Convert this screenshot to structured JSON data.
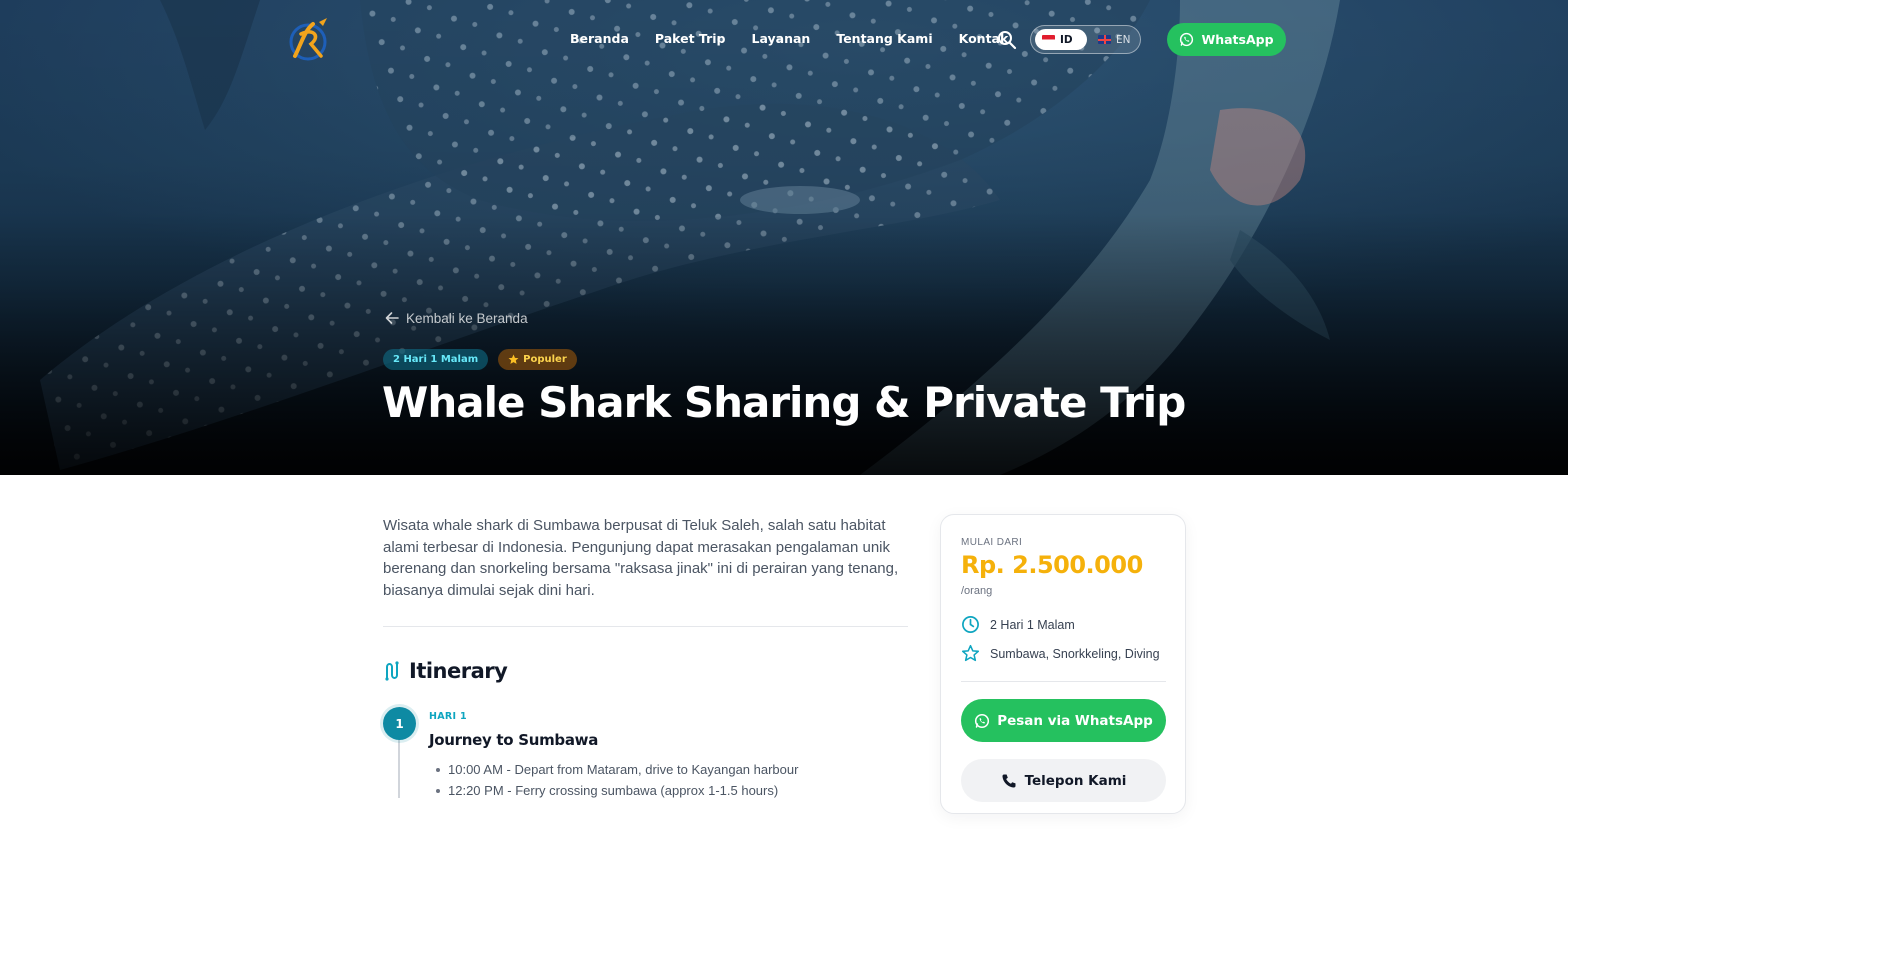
{
  "nav": {
    "links": [
      "Beranda",
      "Paket Trip",
      "Layanan",
      "Tentang Kami",
      "Kontak"
    ],
    "lang": {
      "id": "ID",
      "en": "EN",
      "active": "ID"
    },
    "whatsapp_label": "WhatsApp"
  },
  "hero": {
    "back_label": "Kembali ke Beranda",
    "badge_duration": "2 Hari 1 Malam",
    "badge_popular": "Populer",
    "title": "Whale Shark Sharing & Private Trip"
  },
  "intro": "Wisata whale shark di Sumbawa berpusat di Teluk Saleh, salah satu habitat alami terbesar di Indonesia. Pengunjung dapat merasakan pengalaman unik berenang dan snorkeling bersama \"raksasa jinak\" ini di perairan yang tenang, biasanya dimulai sejak dini hari.",
  "itinerary": {
    "title": "Itinerary",
    "days": [
      {
        "number": "1",
        "label": "HARI 1",
        "title": "Journey to Sumbawa",
        "items": [
          "10:00 AM - Depart from Mataram, drive to Kayangan harbour",
          "12:20 PM - Ferry crossing sumbawa (approx 1-1.5 hours)"
        ]
      }
    ]
  },
  "card": {
    "label": "MULAI DARI",
    "price": "Rp. 2.500.000",
    "unit": "/orang",
    "duration": "2 Hari 1 Malam",
    "tags": "Sumbawa, Snorkkeling, Diving",
    "whatsapp_label": "Pesan via WhatsApp",
    "call_label": "Telepon Kami"
  },
  "colors": {
    "whatsapp_green": "#25c15f",
    "accent_teal": "#0e8aa3",
    "price_gold": "#f5b10b"
  },
  "icons": {
    "logo": "rj-logo",
    "search": "search-icon",
    "whatsapp": "whatsapp-icon",
    "back": "arrow-left-icon",
    "star": "star-icon",
    "itinerary": "route-icon",
    "clock": "clock-icon",
    "phone": "phone-icon"
  }
}
